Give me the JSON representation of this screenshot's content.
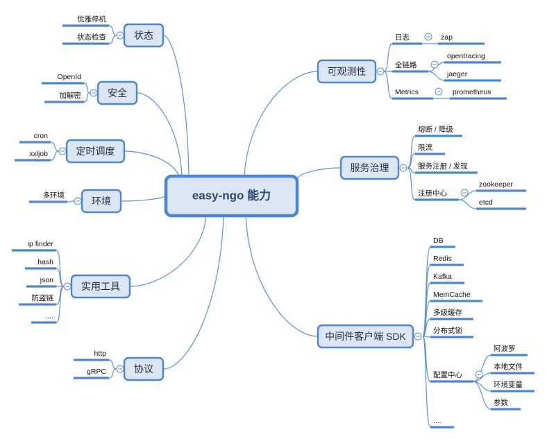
{
  "root": {
    "label": "easy-ngo 能力"
  },
  "left": [
    {
      "id": "status",
      "label": "状态",
      "children": [
        "优雅停机",
        "状态检查"
      ]
    },
    {
      "id": "security",
      "label": "安全",
      "children": [
        "OpenId",
        "加解密"
      ]
    },
    {
      "id": "scheduler",
      "label": "定时调度",
      "children": [
        "cron",
        "xxljob"
      ]
    },
    {
      "id": "env",
      "label": "环境",
      "children": [
        "多环境"
      ]
    },
    {
      "id": "tools",
      "label": "实用工具",
      "children": [
        "ip finder",
        "hash",
        "json",
        "防盗链",
        "...."
      ]
    },
    {
      "id": "protocol",
      "label": "协议",
      "children": [
        "http",
        "gRPC"
      ]
    }
  ],
  "right": [
    {
      "id": "observability",
      "label": "可观测性",
      "children": [
        {
          "label": "日志",
          "children": [
            "zap"
          ]
        },
        {
          "label": "全链路",
          "children": [
            "opentracing",
            "jaeger"
          ]
        },
        {
          "label": "Metrics",
          "children": [
            "prometheus"
          ]
        }
      ]
    },
    {
      "id": "governance",
      "label": "服务治理",
      "children": [
        {
          "label": "熔断 / 降级",
          "children": []
        },
        {
          "label": "限流",
          "children": []
        },
        {
          "label": "服务注册 / 发现",
          "children": []
        },
        {
          "label": "注册中心",
          "children": [
            "zookeeper",
            "etcd"
          ]
        }
      ]
    },
    {
      "id": "middleware",
      "label": "中间件客户端 SDK",
      "children": [
        {
          "label": "DB",
          "children": []
        },
        {
          "label": "Redis",
          "children": []
        },
        {
          "label": "Kafka",
          "children": []
        },
        {
          "label": "MemCache",
          "children": []
        },
        {
          "label": "多级缓存",
          "children": []
        },
        {
          "label": "分布式锁",
          "children": []
        },
        {
          "label": "配置中心",
          "children": [
            "阿波罗",
            "本地文件",
            "环境变量",
            "参数"
          ]
        },
        {
          "label": "....",
          "children": []
        }
      ]
    }
  ],
  "colors": {
    "accent": "#4a86d4",
    "node_fill": "#dce6f3",
    "node_text": "#1f2f4a",
    "root_text": "#2a4a75"
  }
}
